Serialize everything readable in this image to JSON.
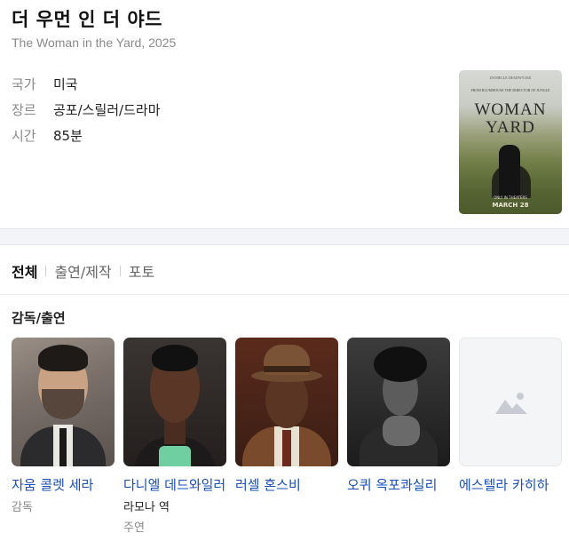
{
  "movie": {
    "title": "더 우먼 인 더 야드",
    "subtitle": "The Woman in the Yard, 2025",
    "info": [
      {
        "label": "국가",
        "value": "미국"
      },
      {
        "label": "장르",
        "value": "공포/스릴러/드라마"
      },
      {
        "label": "시간",
        "value": "85분"
      }
    ],
    "poster": {
      "credit": "DANIELLE DEADWYLER",
      "line": "FROM BLUMHOUSE  THE DIRECTOR OF JUNGLE",
      "title_top": "WOMAN",
      "title_bottom": "YARD",
      "date_small": "ONLY IN THEATERS",
      "date_big": "MARCH 28"
    }
  },
  "tabs": [
    {
      "label": "전체",
      "active": true
    },
    {
      "label": "출연/제작",
      "active": false
    },
    {
      "label": "포토",
      "active": false
    }
  ],
  "section_title": "감독/출연",
  "cast": [
    {
      "name": "자움 콜렛 세라",
      "role": "",
      "kind": "감독",
      "photo": "director-photo"
    },
    {
      "name": "다니엘 데드와일러",
      "role": "라모나 역",
      "kind": "주연",
      "photo": "actor-photo"
    },
    {
      "name": "러셀 혼스비",
      "role": "",
      "kind": "",
      "photo": "actor-photo"
    },
    {
      "name": "오퀴 옥포콰실리",
      "role": "",
      "kind": "",
      "photo": "actor-photo"
    },
    {
      "name": "에스텔라 카히하",
      "role": "",
      "kind": "",
      "photo": "image-placeholder-icon"
    }
  ]
}
